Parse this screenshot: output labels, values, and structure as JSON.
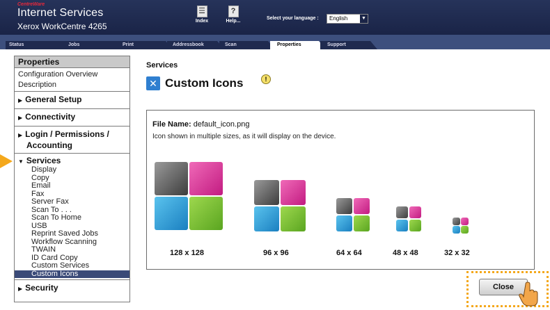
{
  "header": {
    "brand_small": "CentreWare",
    "brand_title": "Internet Services",
    "model": "Xerox WorkCentre 4265",
    "index_label": "Index",
    "help_label": "Help...",
    "language_label": "Select your language :",
    "language_value": "English"
  },
  "tabs": [
    {
      "label": "Status"
    },
    {
      "label": "Jobs"
    },
    {
      "label": "Print"
    },
    {
      "label": "Addressbook"
    },
    {
      "label": "Scan"
    },
    {
      "label": "Properties"
    },
    {
      "label": "Support"
    }
  ],
  "sidebar": {
    "header": "Properties",
    "config_line1": "Configuration Overview",
    "config_line2": "Description",
    "general_setup": "General Setup",
    "connectivity": "Connectivity",
    "login_line1": "Login / Permissions /",
    "login_line2": "Accounting",
    "services_title": "Services",
    "services_items": [
      "Display",
      "Copy",
      "Email",
      "Fax",
      "Server Fax",
      "Scan To . . .",
      "Scan To Home",
      "USB",
      "Reprint Saved Jobs",
      "Workflow Scanning",
      "TWAIN",
      "ID Card Copy",
      "Custom Services",
      "Custom Icons"
    ],
    "selected_item": "Custom Icons",
    "security": "Security"
  },
  "main": {
    "section_title": "Services",
    "page_title": "Custom Icons",
    "file_name_label": "File Name:",
    "file_name_value": "default_icon.png",
    "description": "Icon shown  in multiple  sizes, as it will display on the device.",
    "sizes": [
      "128 x 128",
      "96 x 96",
      "64 x 64",
      "48 x 48",
      "32 x 32"
    ]
  },
  "close_label": "Close",
  "colors": {
    "header_bg": "#1a2447",
    "selected_bg": "#3a4a78",
    "highlight": "#f4a81c"
  }
}
